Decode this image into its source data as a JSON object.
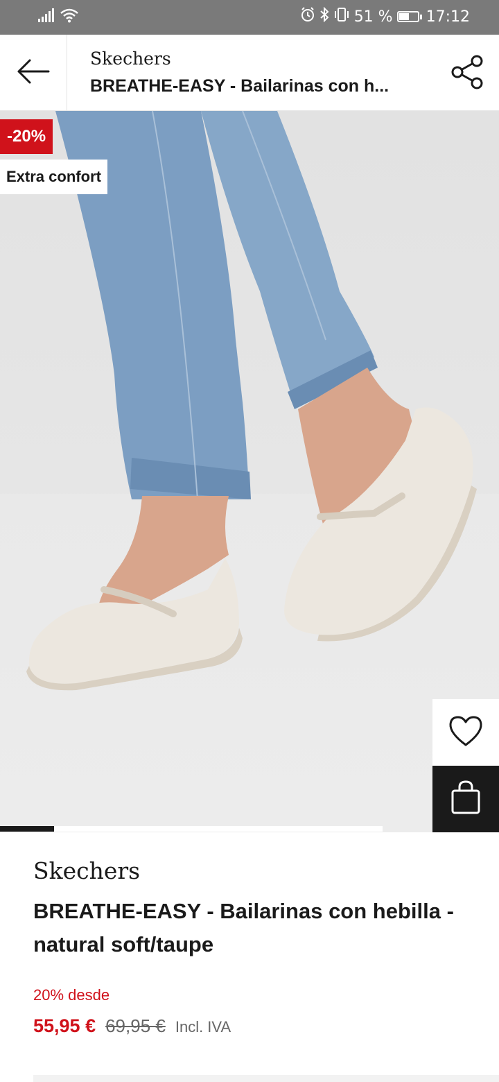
{
  "status_bar": {
    "battery": "51 %",
    "time": "17:12",
    "icons": [
      "signal-icon",
      "wifi-icon",
      "alarm-icon",
      "bluetooth-icon",
      "vibrate-icon",
      "battery-icon"
    ]
  },
  "header": {
    "brand": "Skechers",
    "title": "BREATHE-EASY - Bailarinas con h...",
    "back_icon": "arrow-left-icon",
    "share_icon": "share-icon"
  },
  "image": {
    "discount_badge": "-20%",
    "feature_badge": "Extra confort",
    "wishlist_icon": "heart-icon",
    "cart_icon": "shopping-bag-icon",
    "gallery_position": 0.14
  },
  "product": {
    "brand": "Skechers",
    "name": "BREATHE-EASY - Bailarinas con hebilla - natural soft/taupe",
    "discount_text": "20% desde",
    "price": "55,95 €",
    "original_price": "69,95 €",
    "tax_note": "Incl. IVA"
  },
  "colors": {
    "accent_red": "#d0121b",
    "dark": "#1a1a1a",
    "status_bar": "#7a7a7a"
  }
}
